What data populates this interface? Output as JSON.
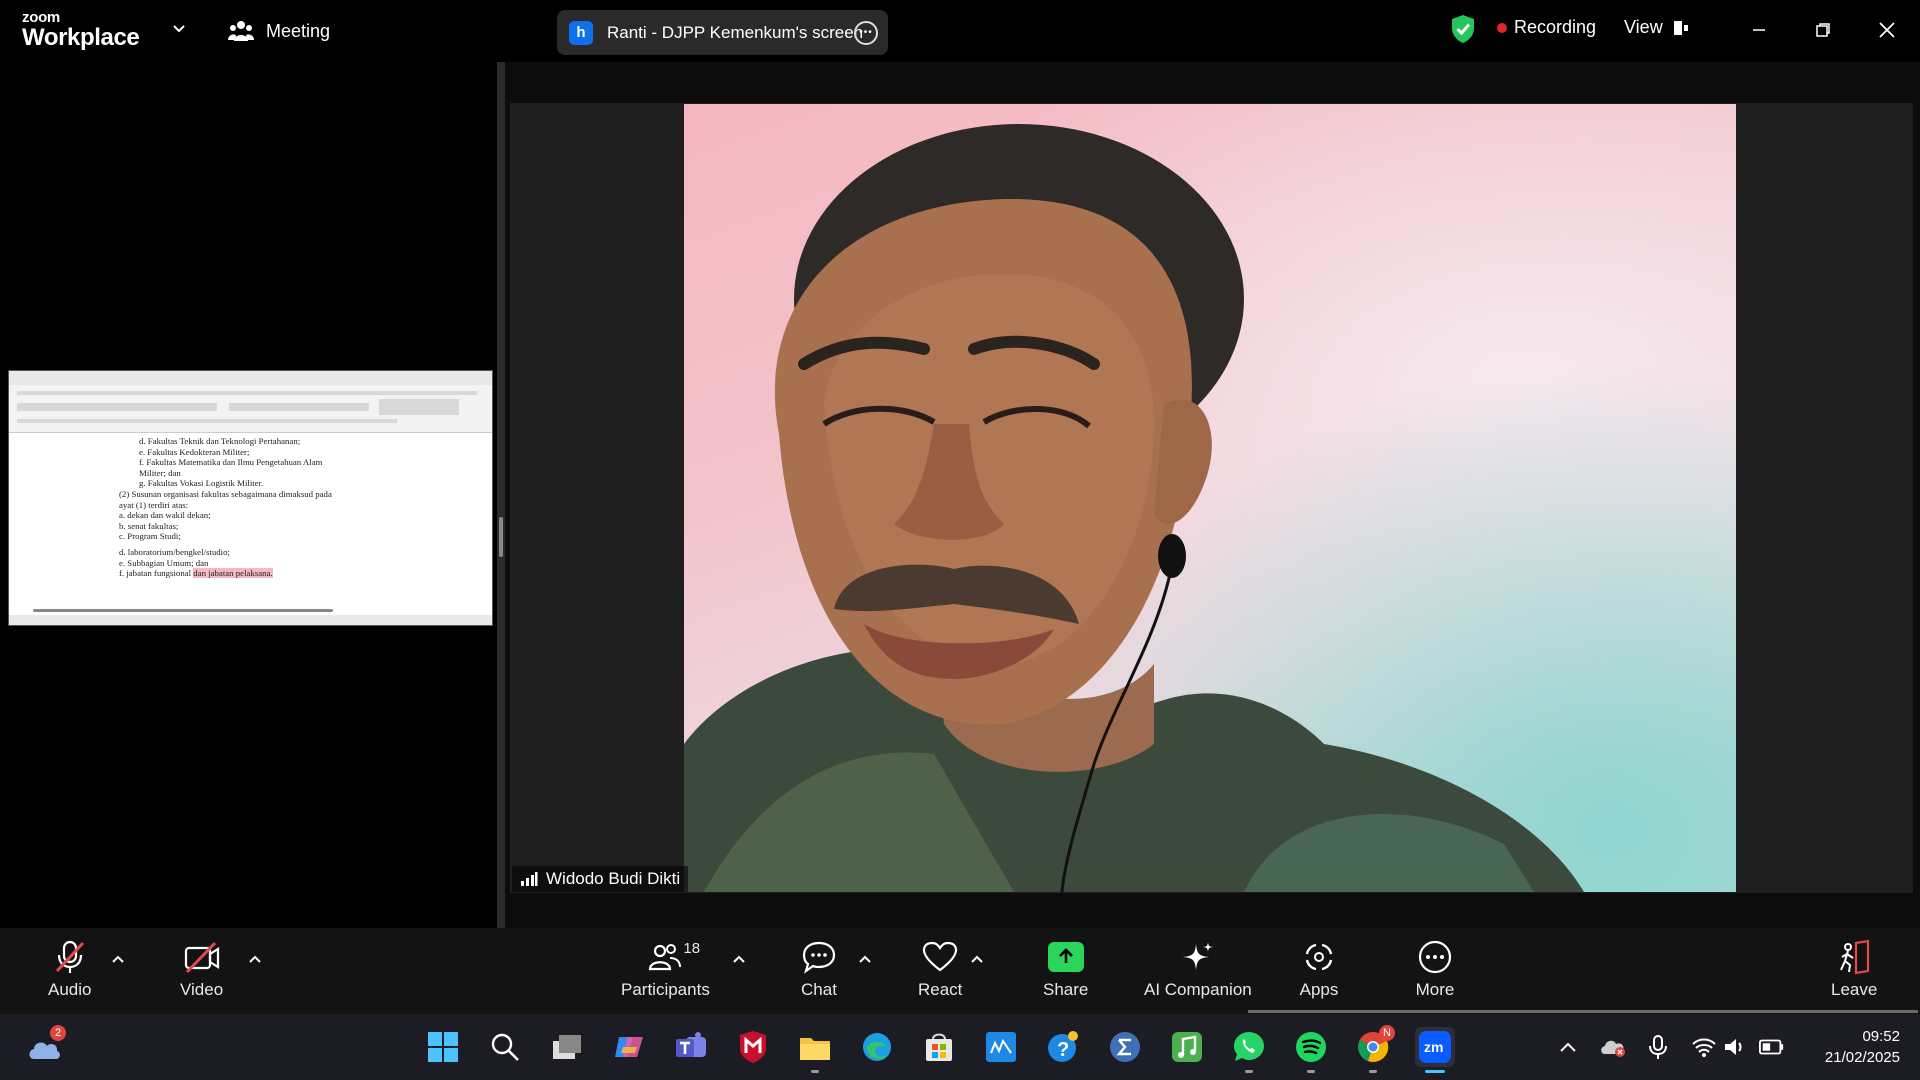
{
  "app": {
    "logo_top": "zoom",
    "logo_bottom": "Workplace",
    "meeting_label": "Meeting",
    "share_indicator": {
      "badge": "h",
      "text": "Ranti - DJPP Kemenkum's screen"
    },
    "recording_label": "Recording",
    "view_label": "View"
  },
  "shared_document": {
    "lines": [
      "d.   Fakultas Teknik dan Teknologi Pertahanan;",
      "e.   Fakultas Kedokteran Militer;",
      "f.   Fakultas  Matematika  dan  Ilmu  Pengetahuan  Alam",
      "      Militer; dan",
      "g.   Fakultas Vokasi Logistik Militer.",
      "(2)   Susunan organisasi fakultas sebagaimana dimaksud pada",
      "        ayat (1) terdiri atas:",
      "        a.   dekan dan wakil dekan;",
      "        b.   senat fakultas;",
      "        c.   Program Studi;",
      "        d.   laboratorium/bengkel/studio;",
      "        e.   Subbagian Umum; dan"
    ],
    "last_line_prefix": "        f.   jabatan fungsional ",
    "last_line_highlight": "dan jabatan pelaksana."
  },
  "participant": {
    "name": "Widodo Budi Dikti"
  },
  "toolbar": {
    "audio": "Audio",
    "video": "Video",
    "participants": "Participants",
    "participants_count": "18",
    "chat": "Chat",
    "react": "React",
    "share": "Share",
    "ai_companion": "AI Companion",
    "apps": "Apps",
    "more": "More",
    "leave": "Leave"
  },
  "taskbar": {
    "weather_badge": "2",
    "chrome_badge": "N",
    "time": "09:52",
    "date": "21/02/2025"
  },
  "colors": {
    "accent_blue": "#0e71eb",
    "share_green": "#2bd45b",
    "recording_red": "#e02828",
    "shield_green": "#22c55e",
    "leave_red": "#e5484d"
  }
}
